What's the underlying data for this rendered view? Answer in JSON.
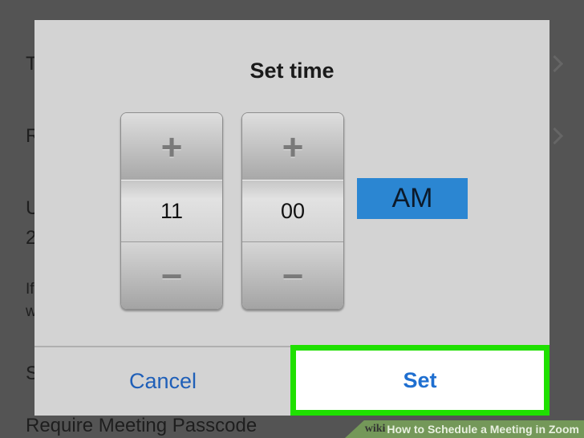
{
  "background": {
    "labels": [
      "T",
      "R",
      "U",
      "2",
      "If",
      "w",
      "S",
      "Require Meeting Passcode"
    ]
  },
  "dialog": {
    "title": "Set time",
    "hour": {
      "increment": "+",
      "value": "11",
      "decrement": "−"
    },
    "minute": {
      "increment": "+",
      "value": "00",
      "decrement": "−"
    },
    "ampm": "AM",
    "cancel_label": "Cancel",
    "set_label": "Set"
  },
  "watermark": {
    "brand": "wiki",
    "text": "How to Schedule a Meeting in Zoom"
  },
  "colors": {
    "accent": "#2b86d2",
    "highlight": "#1fe000",
    "link": "#1f5fb8"
  }
}
